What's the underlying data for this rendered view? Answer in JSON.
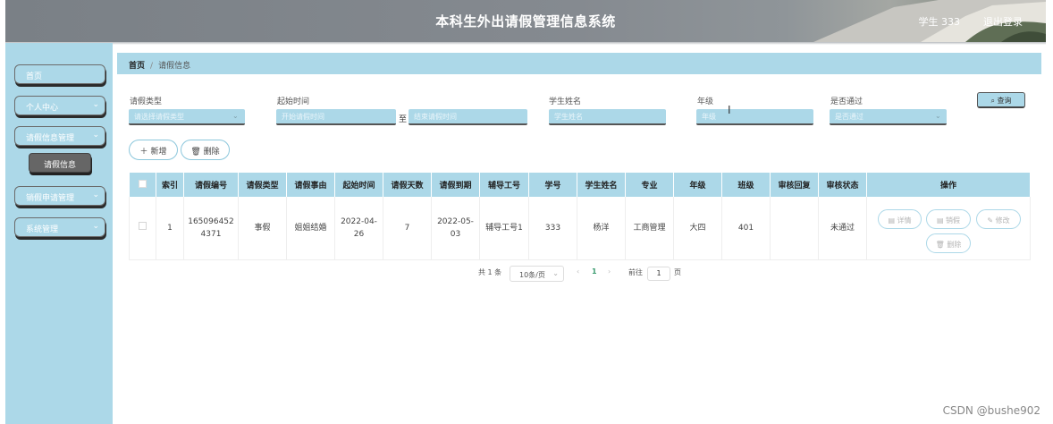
{
  "header": {
    "title": "本科生外出请假管理信息系统",
    "user": "学生 333",
    "logout": "退出登录"
  },
  "sidebar": {
    "items": [
      {
        "label": "首页",
        "has_chevron": false
      },
      {
        "label": "个人中心",
        "has_chevron": true
      },
      {
        "label": "请假信息管理",
        "has_chevron": true
      },
      {
        "label": "请假信息",
        "sub": true
      },
      {
        "label": "销假申请管理",
        "has_chevron": true
      },
      {
        "label": "系统管理",
        "has_chevron": true
      }
    ]
  },
  "breadcrumb": {
    "home": "首页",
    "current": "请假信息"
  },
  "search": {
    "labels": {
      "type": "请假类型",
      "start": "起始时间",
      "name": "学生姓名",
      "grade": "年级",
      "passed": "是否通过"
    },
    "placeholders": {
      "type": "请选择请假类型",
      "start_from": "开始请假时间",
      "start_to": "结束请假时间",
      "name": "学生姓名",
      "grade": "年级",
      "passed": "是否通过"
    },
    "to": "至",
    "button": "查询",
    "button_icon": "search-icon"
  },
  "actions": {
    "add": "新增",
    "delete": "删除"
  },
  "table": {
    "headers": [
      "索引",
      "请假编号",
      "请假类型",
      "请假事由",
      "起始时间",
      "请假天数",
      "请假到期",
      "辅导工号",
      "学号",
      "学生姓名",
      "专业",
      "年级",
      "班级",
      "审核回复",
      "审核状态",
      "操作"
    ],
    "rows": [
      {
        "index": "1",
        "leave_no": "1650964524371",
        "type": "事假",
        "reason": "姐姐结婚",
        "start": "2022-04-26",
        "days": "7",
        "due": "2022-05-03",
        "counselor_no": "辅导工号1",
        "student_no": "333",
        "student_name": "杨洋",
        "major": "工商管理",
        "grade": "大四",
        "class": "401",
        "reply": "",
        "status": "未通过"
      }
    ],
    "ops": {
      "detail": "详情",
      "cancel": "销假",
      "edit": "修改",
      "delete": "删除"
    }
  },
  "pagination": {
    "total": "共 1 条",
    "page_size": "10条/页",
    "current": "1",
    "goto": "前往",
    "goto_value": "1",
    "page_unit": "页"
  },
  "colors": {
    "accent": "#acd8e8",
    "header": "#858a90",
    "submenu": "#666666"
  },
  "watermark": "CSDN @bushe902"
}
